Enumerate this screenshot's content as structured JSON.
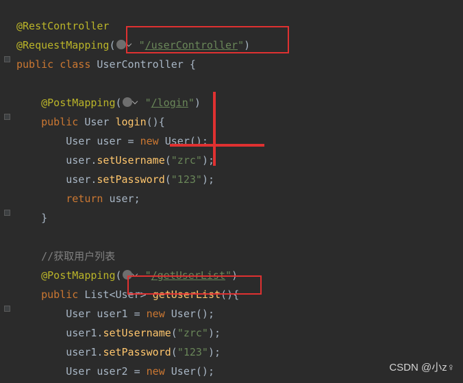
{
  "code": {
    "l1_ann": "@RestController",
    "l2_ann": "@RequestMapping",
    "l2_open": "(",
    "l2_str1": "\"",
    "l2_url": "/userController",
    "l2_str2": "\"",
    "l2_close": ")",
    "l3_kw1": "public ",
    "l3_kw2": "class ",
    "l3_name": "UserController {",
    "l5_ann": "@PostMapping",
    "l5_open": "(",
    "l5_str1": "\"",
    "l5_url": "/login",
    "l5_str2": "\"",
    "l5_close": ")",
    "l6_kw": "public ",
    "l6_type": "User ",
    "l6_method": "login",
    "l6_rest": "(){",
    "l7_type": "User ",
    "l7_var": "user = ",
    "l7_kw": "new ",
    "l7_ctor": "User();",
    "l8_var": "user.",
    "l8_method": "setUsername",
    "l8_open": "(",
    "l8_str": "\"zrc\"",
    "l8_close": ");",
    "l9_var": "user.",
    "l9_method": "setPassword",
    "l9_open": "(",
    "l9_str": "\"123\"",
    "l9_close": ");",
    "l10_kw": "return ",
    "l10_var": "user;",
    "l11": "}",
    "l13_comment": "//获取用户列表",
    "l14_ann": "@PostMapping",
    "l14_open": "(",
    "l14_str1": "\"",
    "l14_url": "/getUserList",
    "l14_str2": "\"",
    "l14_close": ")",
    "l15_kw": "public ",
    "l15_type": "List<User> ",
    "l15_method": "getUserList",
    "l15_rest": "(){",
    "l16_type": "User ",
    "l16_var": "user1 = ",
    "l16_kw": "new ",
    "l16_ctor": "User();",
    "l17_var": "user1.",
    "l17_method": "setUsername",
    "l17_open": "(",
    "l17_str": "\"zrc\"",
    "l17_close": ");",
    "l18_var": "user1.",
    "l18_method": "setPassword",
    "l18_open": "(",
    "l18_str": "\"123\"",
    "l18_close": ");",
    "l19_type": "User ",
    "l19_var": "user2 = ",
    "l19_kw": "new ",
    "l19_ctor": "User();"
  },
  "watermark": "CSDN @小z♀"
}
